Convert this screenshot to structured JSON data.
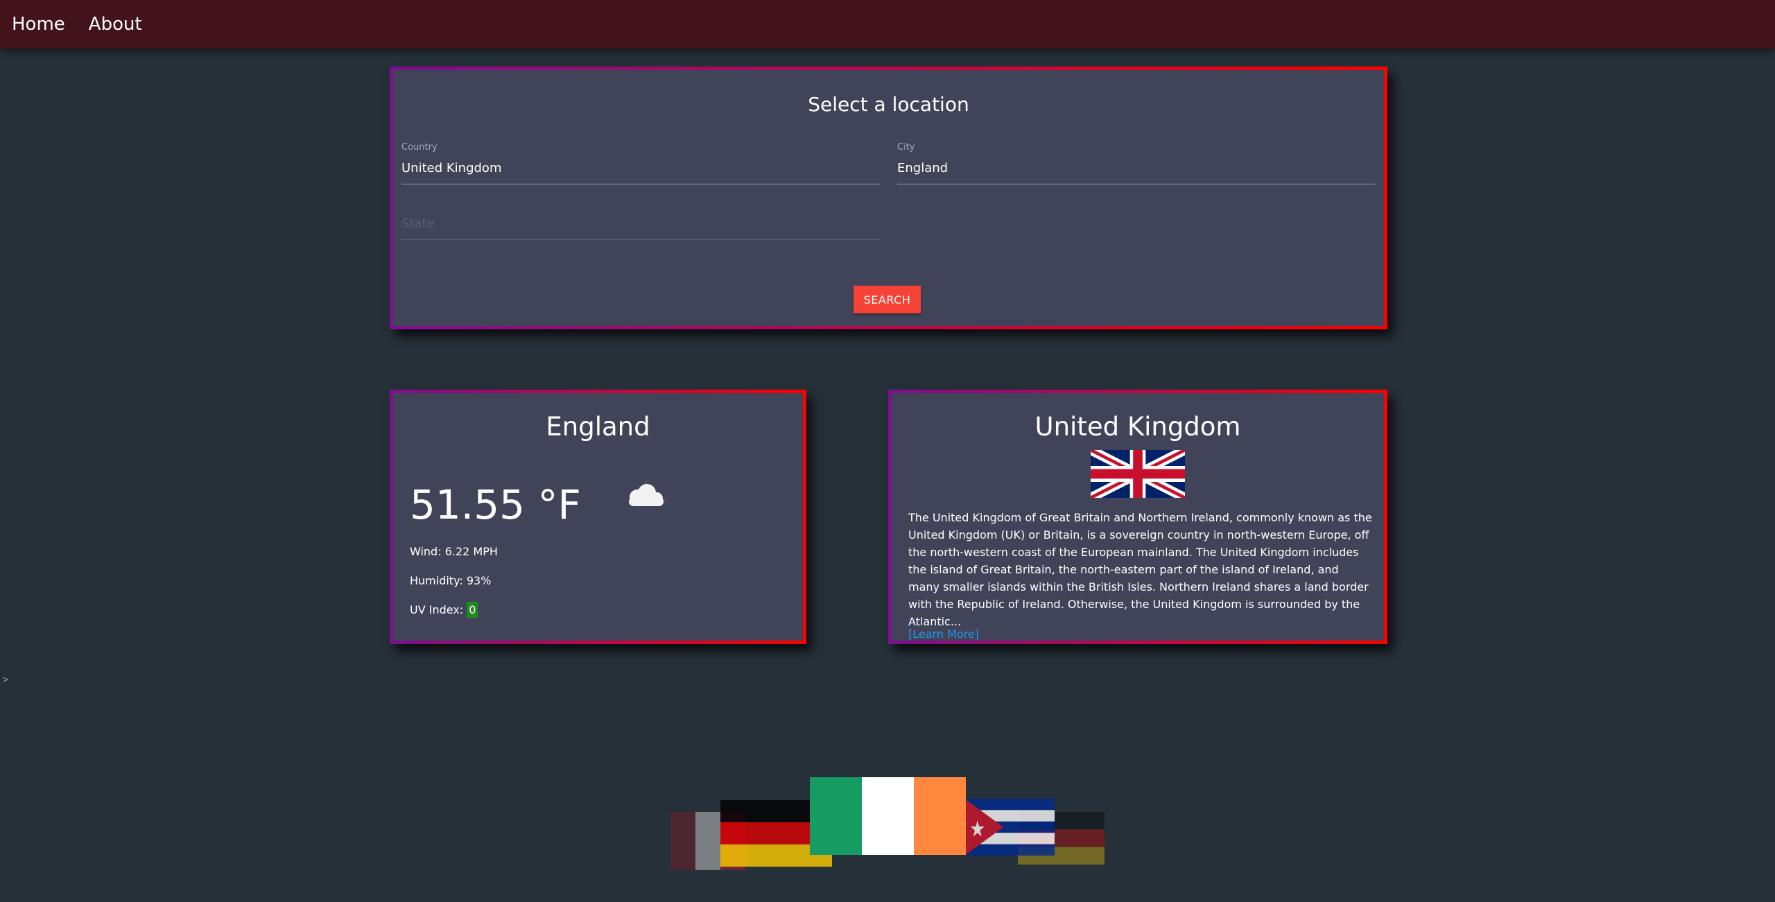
{
  "nav": {
    "home_label": "Home",
    "about_label": "About"
  },
  "search": {
    "title": "Select a location",
    "country_label": "Country",
    "country_value": "United Kingdom",
    "city_label": "City",
    "city_value": "England",
    "state_placeholder": "State",
    "button_label": "SEARCH"
  },
  "weather": {
    "city": "England",
    "temperature": "51.55 °F",
    "icon": "partly-cloudy-night-icon",
    "wind_label": "Wind: 6.22 MPH",
    "humidity_label": "Humidity: 93%",
    "uv_label": "UV Index:",
    "uv_value": "0"
  },
  "country": {
    "name": "United Kingdom",
    "flag": "uk-flag",
    "description": "The United Kingdom of Great Britain and Northern Ireland, commonly known as the United Kingdom (UK) or Britain, is a sovereign country in north-western Europe, off the north-western coast of the European mainland. The United Kingdom includes the island of Great Britain, the north-eastern part of the island of Ireland, and many smaller islands within the British Isles. Northern Ireland shares a land border with the Republic of Ireland. Otherwise, the United Kingdom is surrounded by the Atlantic...",
    "learn_more": "[Learn More]"
  },
  "misc": {
    "caret": ">"
  },
  "carousel": {
    "flags": [
      "belgium-flag",
      "germany-flag",
      "ireland-flag",
      "cuba-flag",
      "germany-flag"
    ]
  },
  "colors": {
    "background": "#263038",
    "navbar": "#43131b",
    "card": "#414459",
    "accent_button": "#f44336",
    "link": "#2196f3",
    "uv_badge": "#1f8a1f"
  }
}
